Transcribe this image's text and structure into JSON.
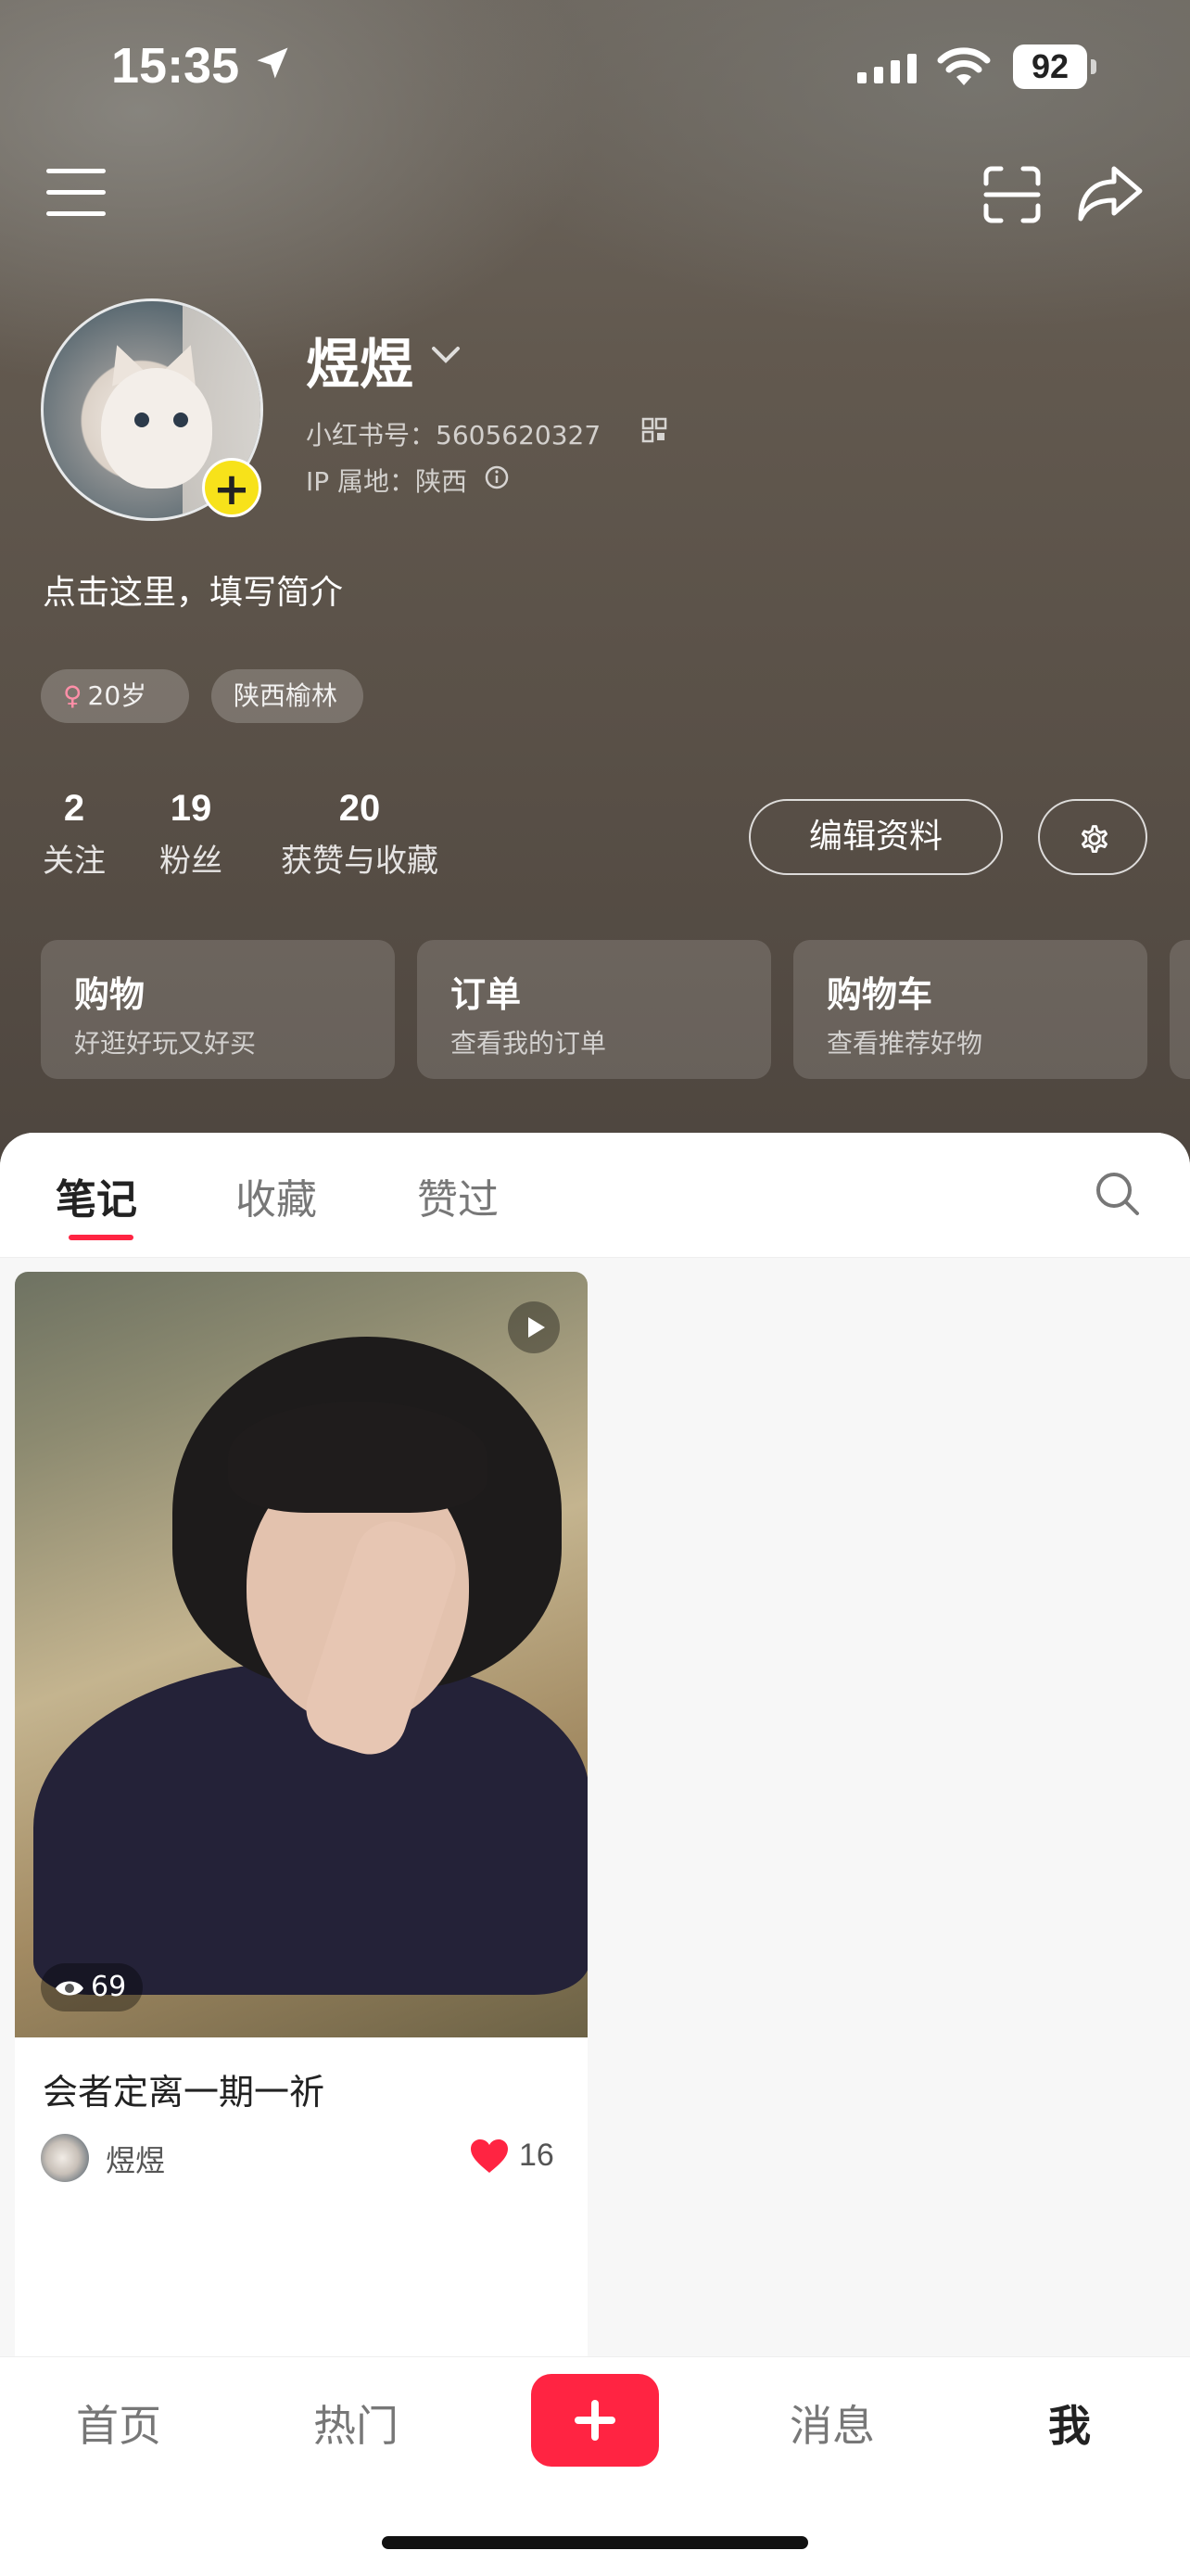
{
  "status_bar": {
    "time": "15:35",
    "battery": "92"
  },
  "profile": {
    "name": "煜煜",
    "red_id": "小红书号：5605620327",
    "ip": "IP 属地：陕西",
    "bio": "点击这里，填写简介",
    "tags": {
      "gender_symbol": "♀",
      "age": "20岁",
      "location": "陕西榆林"
    }
  },
  "stats": [
    {
      "num": "2",
      "label": "关注"
    },
    {
      "num": "19",
      "label": "粉丝"
    },
    {
      "num": "20",
      "label": "获赞与收藏"
    }
  ],
  "actions": {
    "edit_profile": "编辑资料"
  },
  "cards": [
    {
      "title": "购物",
      "subtitle": "好逛好玩又好买"
    },
    {
      "title": "订单",
      "subtitle": "查看我的订单"
    },
    {
      "title": "购物车",
      "subtitle": "查看推荐好物"
    }
  ],
  "tabs": {
    "notes": "笔记",
    "favorites": "收藏",
    "liked": "赞过"
  },
  "note": {
    "views": "69",
    "title": "会者定离一期一祈",
    "author": "煜煜",
    "likes": "16"
  },
  "nav": {
    "home": "首页",
    "hot": "热门",
    "messages": "消息",
    "me": "我"
  },
  "colors": {
    "accent": "#ff2442",
    "avatar_add": "#f7e21a"
  }
}
